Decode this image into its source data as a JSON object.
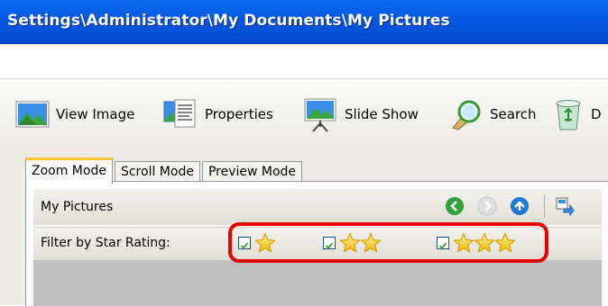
{
  "window": {
    "title": "Settings\\Administrator\\My Documents\\My Pictures"
  },
  "toolbar": {
    "view_image": {
      "label": "View Image",
      "icon": "landscape-picture-icon"
    },
    "properties": {
      "label": "Properties",
      "icon": "properties-sheet-icon"
    },
    "slide_show": {
      "label": "Slide Show",
      "icon": "projector-screen-icon"
    },
    "search": {
      "label": "Search",
      "icon": "magnifier-icon"
    },
    "delete": {
      "label": "D",
      "icon": "recycle-bin-icon"
    }
  },
  "tabs": [
    {
      "label": "Zoom Mode",
      "active": true
    },
    {
      "label": "Scroll Mode",
      "active": false
    },
    {
      "label": "Preview Mode",
      "active": false
    }
  ],
  "nav": {
    "label": "My Pictures",
    "back_icon": "back-arrow-icon",
    "forward_icon": "forward-arrow-icon",
    "up_icon": "up-arrow-icon",
    "extra_icon": "copy-to-folder-icon"
  },
  "filter": {
    "label": "Filter by Star Rating:",
    "options": [
      {
        "stars": 1,
        "checked": true
      },
      {
        "stars": 2,
        "checked": true
      },
      {
        "stars": 3,
        "checked": true
      }
    ]
  },
  "colors": {
    "title_bar": "#0457e2",
    "highlight": "#e80000",
    "tab_accent": "#ffc83c"
  }
}
